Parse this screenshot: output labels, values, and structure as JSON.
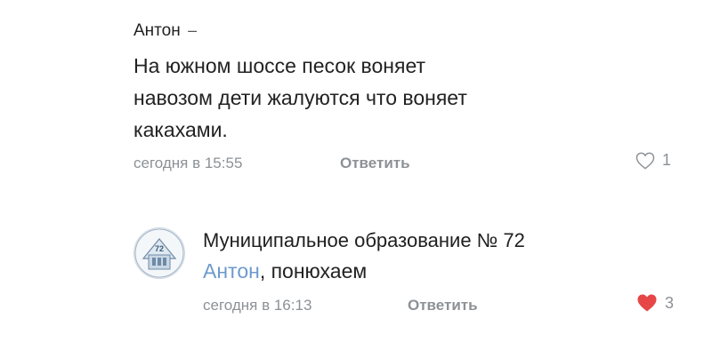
{
  "comments": [
    {
      "author": "Антон",
      "author_suffix": "–",
      "text_lines": [
        "На южном шоссе песок воняет",
        "навозом дети жалуются что воняет",
        "какахами."
      ],
      "date": "сегодня в 15:55",
      "reply_label": "Ответить",
      "likes": "1",
      "liked": false
    },
    {
      "author": "Муниципальное образование № 72",
      "mention": "Антон",
      "text_rest": ", понюхаем",
      "date": "сегодня в 16:13",
      "reply_label": "Ответить",
      "likes": "3",
      "liked": true,
      "avatar_text": "72"
    }
  ],
  "colors": {
    "meta": "#8c9196",
    "mention": "#6d9acb",
    "like_active": "#e64646"
  },
  "icons": {
    "like_empty": "heart-outline-icon",
    "like_filled": "heart-filled-icon"
  }
}
